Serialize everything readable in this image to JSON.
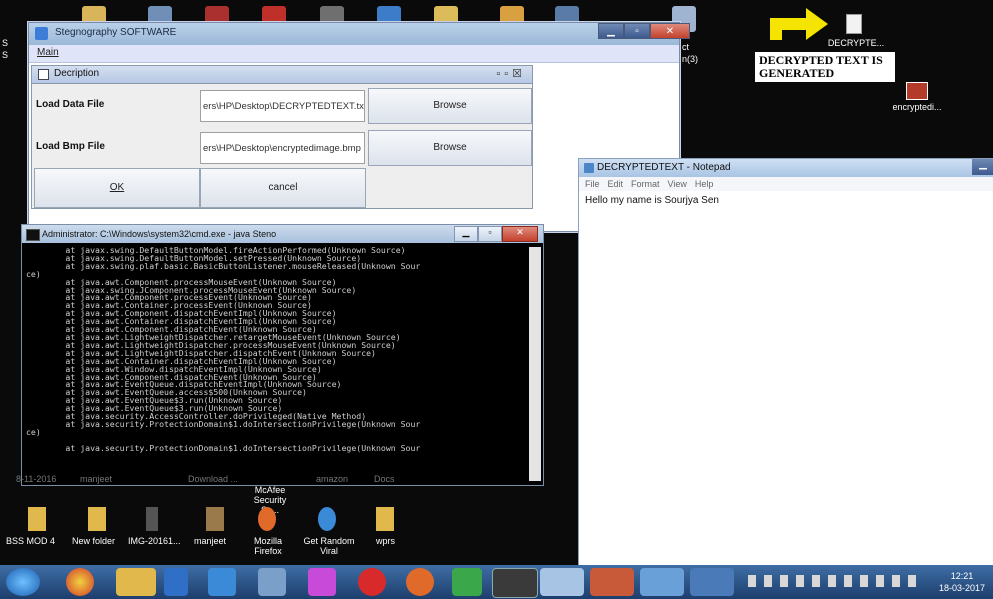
{
  "desktop": {
    "sticker_text": "DECRYPTED TEXT IS GENERATED",
    "top_icon_labels": [
      "DECRYPTE...",
      "encryptedi..."
    ],
    "side_text_left": [
      "S",
      "S"
    ],
    "truncated_label": "ct",
    "truncated_label2": "n(3)",
    "bottom_icons": [
      "BSS MOD 4",
      "New folder",
      "IMG-20161...",
      "manjeet",
      "Mozilla Firefox",
      "Get Random Viral",
      "wprs"
    ],
    "faded_labels": [
      "8-11-2016",
      "manjeet",
      "Download ...",
      "McAfee Security Sc...",
      "amazon",
      "Docs"
    ]
  },
  "stego_window": {
    "title": "Stegnography SOFTWARE",
    "menu": "Main",
    "internal_title": "Decription",
    "rows": [
      {
        "label": "Load Data File",
        "value": "ers\\HP\\Desktop\\DECRYPTEDTEXT.txt",
        "button": "Browse"
      },
      {
        "label": "Load Bmp File",
        "value": "ers\\HP\\Desktop\\encryptedimage.bmp",
        "button": "Browse"
      }
    ],
    "ok_label": "OK",
    "cancel_label": "cancel"
  },
  "notepad": {
    "title": "DECRYPTEDTEXT - Notepad",
    "menu": [
      "File",
      "Edit",
      "Format",
      "View",
      "Help"
    ],
    "content": "Hello my name is Sourjya Sen"
  },
  "cmd": {
    "title": "Administrator: C:\\Windows\\system32\\cmd.exe - java  Steno",
    "lines": [
      "        at javax.swing.DefaultButtonModel.fireActionPerformed(Unknown Source)",
      "        at javax.swing.DefaultButtonModel.setPressed(Unknown Source)",
      "        at javax.swing.plaf.basic.BasicButtonListener.mouseReleased(Unknown Sour",
      "ce)",
      "        at java.awt.Component.processMouseEvent(Unknown Source)",
      "        at javax.swing.JComponent.processMouseEvent(Unknown Source)",
      "        at java.awt.Component.processEvent(Unknown Source)",
      "        at java.awt.Container.processEvent(Unknown Source)",
      "        at java.awt.Component.dispatchEventImpl(Unknown Source)",
      "        at java.awt.Container.dispatchEventImpl(Unknown Source)",
      "        at java.awt.Component.dispatchEvent(Unknown Source)",
      "        at java.awt.LightweightDispatcher.retargetMouseEvent(Unknown Source)",
      "        at java.awt.LightweightDispatcher.processMouseEvent(Unknown Source)",
      "        at java.awt.LightweightDispatcher.dispatchEvent(Unknown Source)",
      "        at java.awt.Container.dispatchEventImpl(Unknown Source)",
      "        at java.awt.Window.dispatchEventImpl(Unknown Source)",
      "        at java.awt.Component.dispatchEvent(Unknown Source)",
      "        at java.awt.EventQueue.dispatchEventImpl(Unknown Source)",
      "        at java.awt.EventQueue.access$500(Unknown Source)",
      "        at java.awt.EventQueue$3.run(Unknown Source)",
      "        at java.awt.EventQueue$3.run(Unknown Source)",
      "        at java.security.AccessController.doPrivileged(Native Method)",
      "        at java.security.ProtectionDomain$1.doIntersectionPrivilege(Unknown Sour",
      "ce)",
      "",
      "        at java.security.ProtectionDomain$1.doIntersectionPrivilege(Unknown Sour"
    ]
  },
  "taskbar": {
    "time": "12:21",
    "date": "18-03-2017"
  },
  "colors": {
    "taskbar": "#2a5488",
    "desktop_bg": "#0a0a0a",
    "sticker_arrow": "#f5e400"
  }
}
